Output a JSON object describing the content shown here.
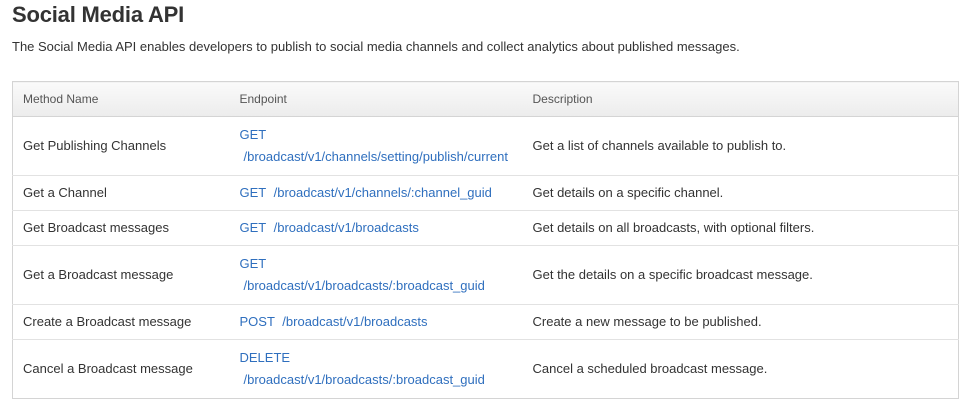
{
  "page": {
    "title": "Social Media API",
    "intro": "The Social Media API enables developers to publish to social media channels and collect analytics about published messages."
  },
  "table": {
    "headers": {
      "method": "Method Name",
      "endpoint": "Endpoint",
      "description": "Description"
    },
    "rows": [
      {
        "method": "Get Publishing Channels",
        "verb": "GET",
        "path": "/broadcast/v1/channels/setting/publish/current",
        "description": "Get a list of channels available to publish to."
      },
      {
        "method": "Get a Channel",
        "verb": "GET",
        "path": "/broadcast/v1/channels/:channel_guid",
        "description": "Get details on a specific channel."
      },
      {
        "method": "Get Broadcast messages",
        "verb": "GET",
        "path": "/broadcast/v1/broadcasts",
        "description": "Get details on all broadcasts, with optional filters."
      },
      {
        "method": "Get a Broadcast message",
        "verb": "GET",
        "path": "/broadcast/v1/broadcasts/:broadcast_guid",
        "description": "Get the details on a specific broadcast message."
      },
      {
        "method": "Create a Broadcast message",
        "verb": "POST",
        "path": "/broadcast/v1/broadcasts",
        "description": "Create a new message to be published."
      },
      {
        "method": "Cancel a Broadcast message",
        "verb": "DELETE",
        "path": "/broadcast/v1/broadcasts/:broadcast_guid",
        "description": "Cancel a scheduled broadcast message."
      }
    ]
  },
  "colors": {
    "link": "#2f6fbe",
    "text": "#333333",
    "border": "#d4d4d4"
  }
}
